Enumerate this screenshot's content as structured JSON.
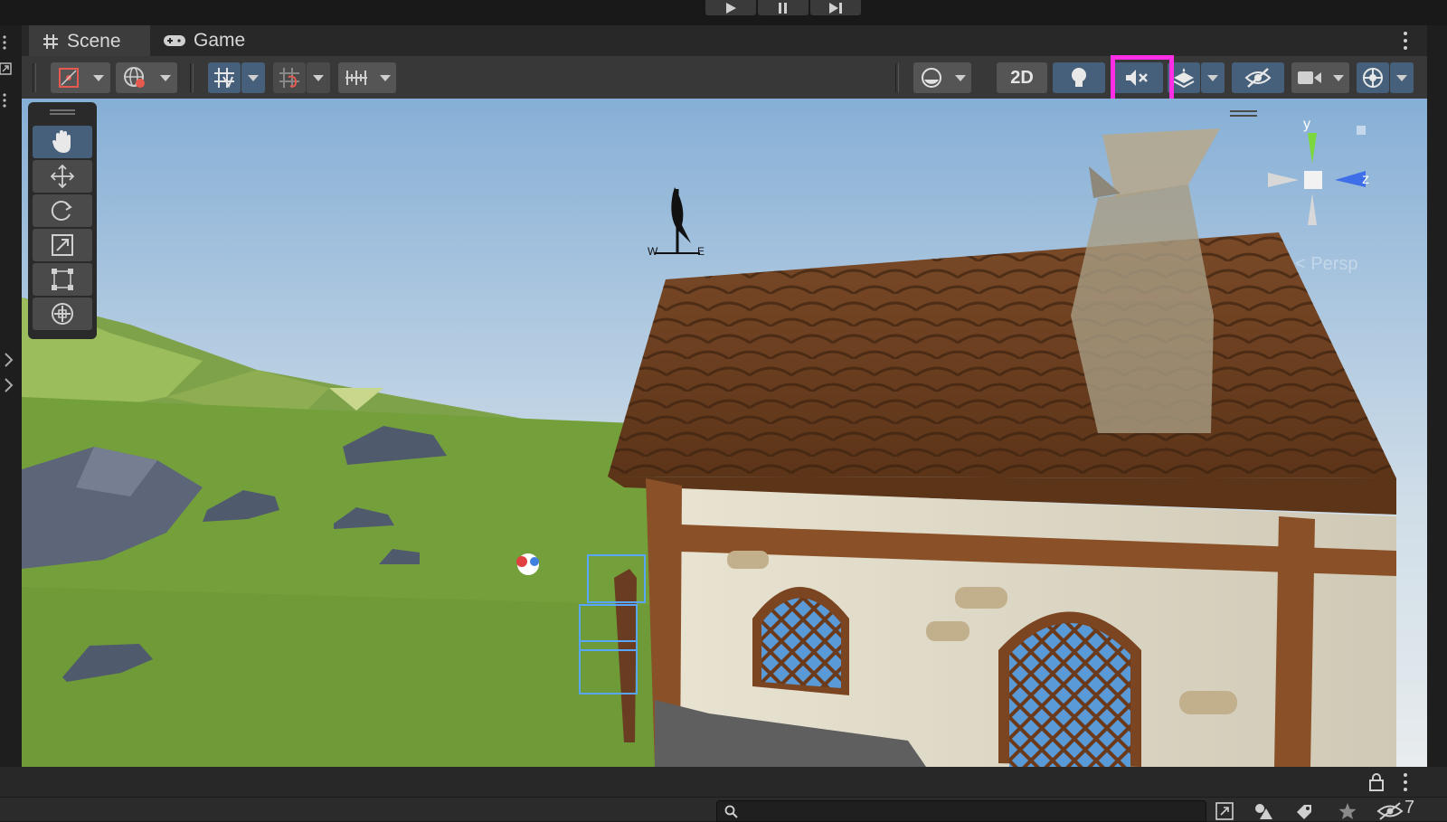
{
  "tabs": [
    {
      "label": "Scene",
      "icon": "grid-hash-icon",
      "active": true
    },
    {
      "label": "Game",
      "icon": "gamepad-icon",
      "active": false
    }
  ],
  "toolbar": {
    "mode_2d_label": "2D"
  },
  "gizmo": {
    "y_label": "y",
    "z_label": "z",
    "projection_label": "< Persp"
  },
  "weathervane": {
    "west": "W",
    "east": "E"
  },
  "bottom": {
    "hidden_count": "7"
  },
  "colors": {
    "highlight": "#ff2ee6",
    "active_button": "#46607c"
  }
}
